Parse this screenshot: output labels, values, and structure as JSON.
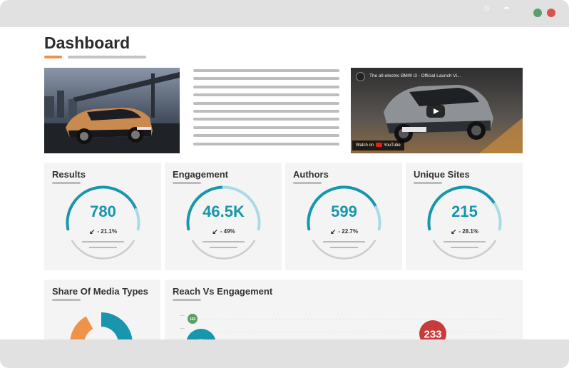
{
  "window": {
    "controls": [
      "maximize-dot",
      "close-dot"
    ],
    "colors": {
      "maximize": "#5a9e6a",
      "close": "#d9534f",
      "chrome": "#e1e1e1"
    }
  },
  "page": {
    "title": "Dashboard",
    "accent_color": "#f0934a"
  },
  "video": {
    "title": "The all-electric BMW i3 - Official Launch Vi...",
    "watch_later": "Watch later",
    "share": "Share",
    "watch_on": "Watch on",
    "platform": "YouTube"
  },
  "metrics": [
    {
      "title": "Results",
      "value": "780",
      "change": "- 21.1%",
      "fraction": 0.84,
      "trend_icon": "arrow-down-left-icon"
    },
    {
      "title": "Engagement",
      "value": "46.5K",
      "change": "- 49%",
      "fraction": 0.5,
      "trend_icon": "arrow-down-left-icon"
    },
    {
      "title": "Authors",
      "value": "599",
      "change": "- 22.7%",
      "fraction": 0.82,
      "trend_icon": "arrow-down-left-icon"
    },
    {
      "title": "Unique Sites",
      "value": "215",
      "change": "- 28.1%",
      "fraction": 0.79,
      "trend_icon": "arrow-down-left-icon"
    }
  ],
  "gauge_colors": {
    "filled": "#1796ad",
    "remaining": "#a9dbe6",
    "bottom": "#cccccc"
  },
  "media_types": {
    "title": "Share Of Media Types",
    "chart_data": {
      "type": "pie",
      "segments": [
        {
          "color": "#1796ad",
          "share": 0.52
        },
        {
          "color": "#9b7fbf",
          "share": 0.2
        },
        {
          "color": "#f0934a",
          "share": 0.2
        },
        {
          "color": "#f4f4f4",
          "share": 0.08
        }
      ]
    }
  },
  "reach": {
    "title": "Reach Vs Engagement",
    "chart_data": {
      "type": "scatter",
      "points": [
        {
          "label": "102",
          "color": "#5a9e6a"
        },
        {
          "label": "233",
          "color": "#c73b3b"
        }
      ]
    }
  }
}
